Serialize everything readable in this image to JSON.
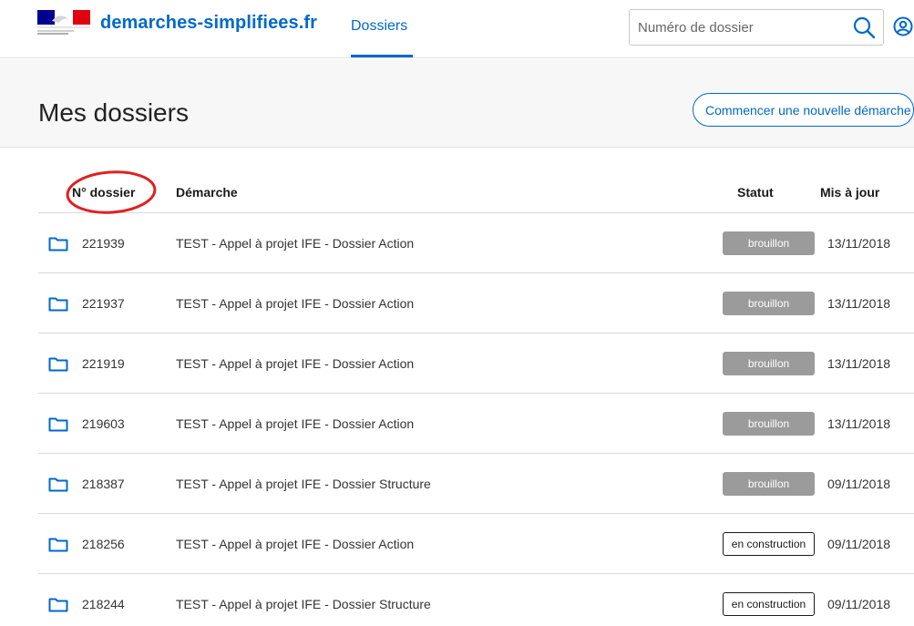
{
  "header": {
    "site_name": "demarches-simplifiees.fr",
    "nav_dossiers": "Dossiers",
    "search_placeholder": "Numéro de dossier"
  },
  "page": {
    "title": "Mes dossiers",
    "new_button": "Commencer une nouvelle démarche"
  },
  "table": {
    "headers": {
      "numero": "N° dossier",
      "demarche": "Démarche",
      "statut": "Statut",
      "mis_a_jour": "Mis à jour"
    },
    "rows": [
      {
        "numero": "221939",
        "demarche": "TEST - Appel à projet IFE - Dossier Action",
        "statut": "brouillon",
        "date": "13/11/2018"
      },
      {
        "numero": "221937",
        "demarche": "TEST - Appel à projet IFE - Dossier Action",
        "statut": "brouillon",
        "date": "13/11/2018"
      },
      {
        "numero": "221919",
        "demarche": "TEST - Appel à projet IFE - Dossier Action",
        "statut": "brouillon",
        "date": "13/11/2018"
      },
      {
        "numero": "219603",
        "demarche": "TEST - Appel à projet IFE - Dossier Action",
        "statut": "brouillon",
        "date": "13/11/2018"
      },
      {
        "numero": "218387",
        "demarche": "TEST - Appel à projet IFE - Dossier Structure",
        "statut": "brouillon",
        "date": "09/11/2018"
      },
      {
        "numero": "218256",
        "demarche": "TEST - Appel à projet IFE - Dossier Action",
        "statut": "en construction",
        "date": "09/11/2018"
      },
      {
        "numero": "218244",
        "demarche": "TEST - Appel à projet IFE - Dossier Structure",
        "statut": "en construction",
        "date": "09/11/2018"
      }
    ]
  },
  "colors": {
    "brand_blue": "#0069cc",
    "badge_grey": "#9b9b9b",
    "annotation_red": "#e02020"
  },
  "icons": {
    "logo": "republique-francaise-logo",
    "search": "search-icon",
    "user": "user-account-icon",
    "folder": "folder-icon"
  }
}
